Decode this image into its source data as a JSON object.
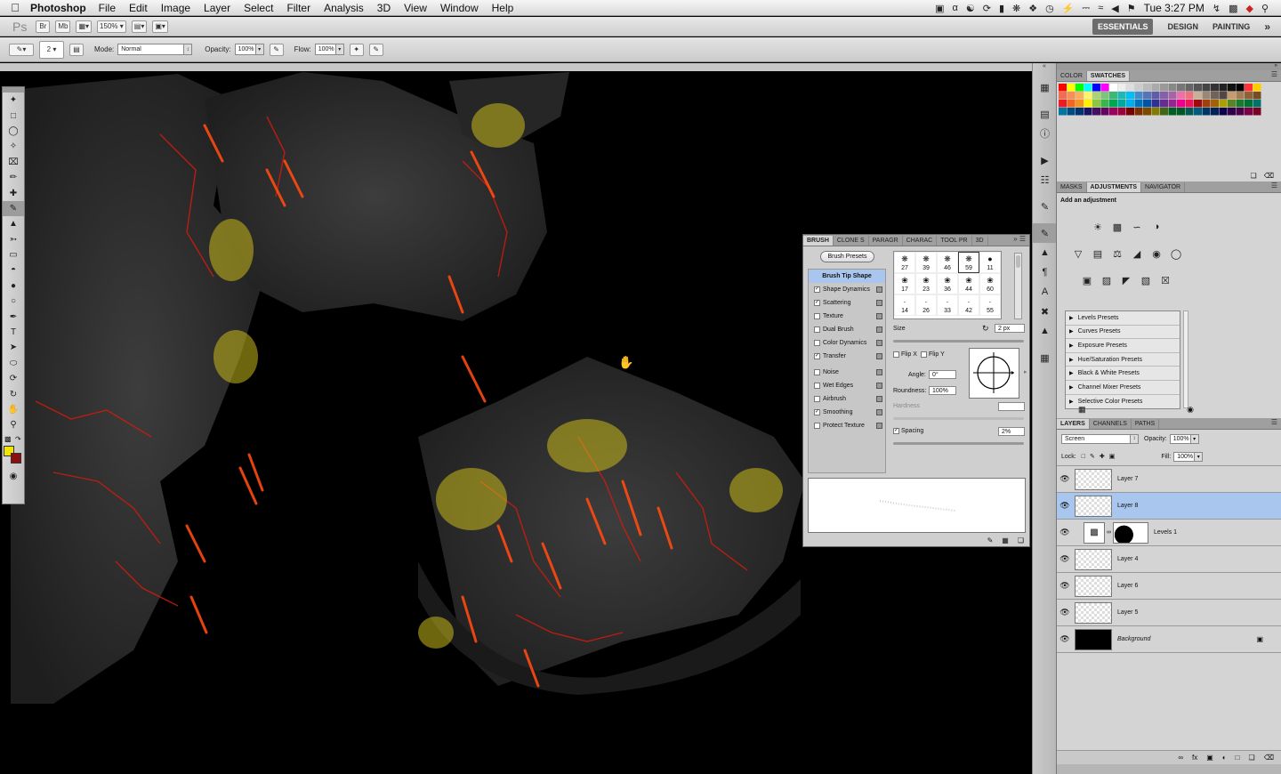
{
  "menubar": {
    "app_name": "Photoshop",
    "menus": [
      "File",
      "Edit",
      "Image",
      "Layer",
      "Select",
      "Filter",
      "Analysis",
      "3D",
      "View",
      "Window",
      "Help"
    ],
    "clock": "Tue 3:27 PM"
  },
  "appbar": {
    "logo": "Ps",
    "zoom": "150%",
    "workspaces": [
      "ESSENTIALS",
      "DESIGN",
      "PAINTING"
    ],
    "br_label": "Br",
    "mb_label": "Mb"
  },
  "options": {
    "brush_size": "2",
    "mode_label": "Mode:",
    "mode_value": "Normal",
    "opacity_label": "Opacity:",
    "opacity_value": "100%",
    "flow_label": "Flow:",
    "flow_value": "100%"
  },
  "colors": {
    "foreground": "#f2e400",
    "background": "#8c0f0f",
    "accent_selection": "#a9c7ee"
  },
  "brush_panel": {
    "tabs": [
      "BRUSH",
      "CLONE S",
      "PARAGR",
      "CHARAC",
      "TOOL PR",
      "3D"
    ],
    "presets_button": "Brush Presets",
    "options": [
      {
        "label": "Brush Tip Shape",
        "checked": null,
        "active": true
      },
      {
        "label": "Shape Dynamics",
        "checked": true
      },
      {
        "label": "Scattering",
        "checked": true
      },
      {
        "label": "Texture",
        "checked": false
      },
      {
        "label": "Dual Brush",
        "checked": false
      },
      {
        "label": "Color Dynamics",
        "checked": false
      },
      {
        "label": "Transfer",
        "checked": true
      },
      {
        "label": "Noise",
        "checked": false
      },
      {
        "label": "Wet Edges",
        "checked": false
      },
      {
        "label": "Airbrush",
        "checked": false
      },
      {
        "label": "Smoothing",
        "checked": true
      },
      {
        "label": "Protect Texture",
        "checked": false
      }
    ],
    "tips": [
      "27",
      "39",
      "46",
      "59",
      "11",
      "17",
      "23",
      "36",
      "44",
      "60",
      "14",
      "26",
      "33",
      "42",
      "55"
    ],
    "size_label": "Size",
    "size_value": "2 px",
    "flip_x": "Flip X",
    "flip_y": "Flip Y",
    "angle_label": "Angle:",
    "angle_value": "0°",
    "roundness_label": "Roundness:",
    "roundness_value": "100%",
    "hardness_label": "Hardness",
    "spacing_label": "Spacing",
    "spacing_value": "2%"
  },
  "color_panel": {
    "tabs": [
      "COLOR",
      "SWATCHES"
    ]
  },
  "adjustments_panel": {
    "tabs": [
      "MASKS",
      "ADJUSTMENTS",
      "NAVIGATOR"
    ],
    "heading": "Add an adjustment",
    "presets": [
      "Levels Presets",
      "Curves Presets",
      "Exposure Presets",
      "Hue/Saturation Presets",
      "Black & White Presets",
      "Channel Mixer Presets",
      "Selective Color Presets"
    ]
  },
  "layers_panel": {
    "tabs": [
      "LAYERS",
      "CHANNELS",
      "PATHS"
    ],
    "blend_mode": "Screen",
    "opacity_label": "Opacity:",
    "opacity_value": "100%",
    "lock_label": "Lock:",
    "fill_label": "Fill:",
    "fill_value": "100%",
    "layers": [
      {
        "name": "Layer 7",
        "selected": false
      },
      {
        "name": "Layer 8",
        "selected": true
      },
      {
        "name": "Levels 1",
        "selected": false,
        "adjustment": true
      },
      {
        "name": "Layer 4",
        "selected": false
      },
      {
        "name": "Layer 6",
        "selected": false
      },
      {
        "name": "Layer 5",
        "selected": false
      },
      {
        "name": "Background",
        "selected": false,
        "background": true
      }
    ]
  }
}
